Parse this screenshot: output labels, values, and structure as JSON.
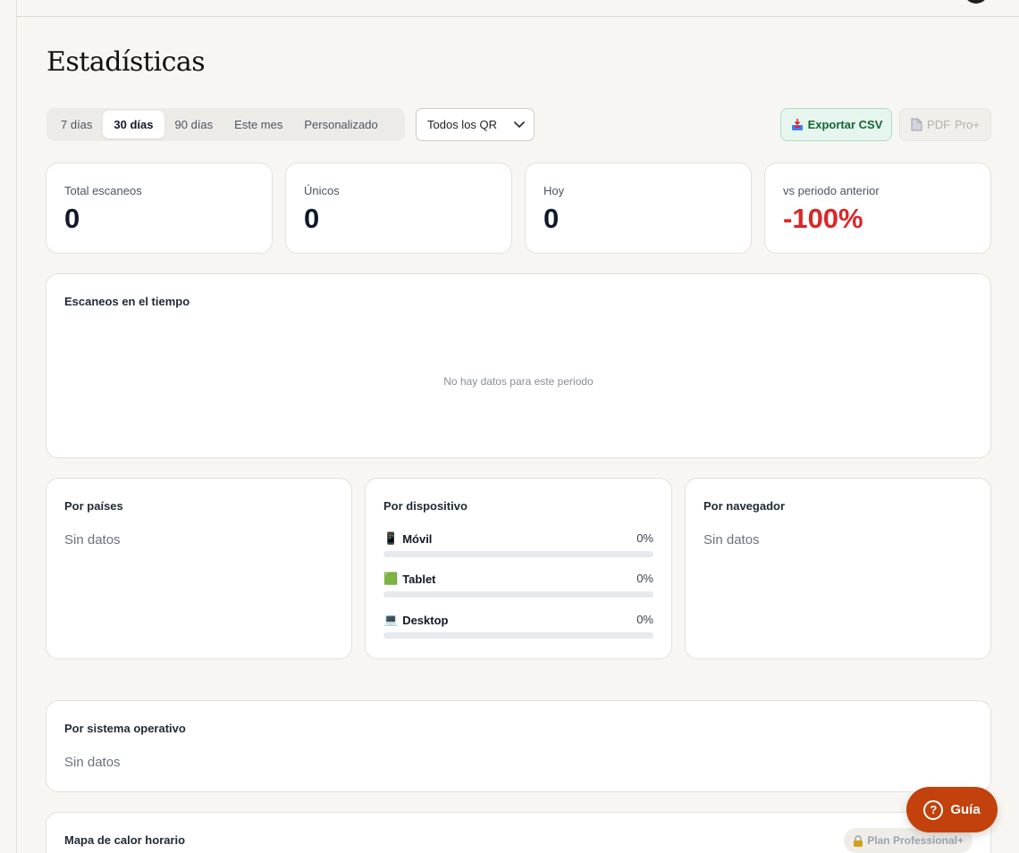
{
  "header": {
    "title": "Estadísticas"
  },
  "filters": {
    "ranges": [
      {
        "label": "7 días",
        "active": false
      },
      {
        "label": "30 días",
        "active": true
      },
      {
        "label": "90 días",
        "active": false
      },
      {
        "label": "Este mes",
        "active": false
      },
      {
        "label": "Personalizado",
        "active": false
      }
    ],
    "qr_select": {
      "value": "Todos los QR",
      "icon": "chevron-down-icon"
    }
  },
  "actions": {
    "csv": {
      "label": "Exportar CSV",
      "icon": "inbox-tray-icon"
    },
    "pdf": {
      "label": "PDF",
      "tag": "Pro+",
      "icon": "document-icon"
    }
  },
  "stats": [
    {
      "label": "Total escaneos",
      "value": "0"
    },
    {
      "label": "Únicos",
      "value": "0"
    },
    {
      "label": "Hoy",
      "value": "0"
    },
    {
      "label": "vs periodo anterior",
      "value": "-100%"
    }
  ],
  "timeline": {
    "title": "Escaneos en el tiempo",
    "empty": "No hay datos para este periodo"
  },
  "countries": {
    "title": "Por países",
    "empty": "Sin datos"
  },
  "devices": {
    "title": "Por dispositivo",
    "items": [
      {
        "icon": "📱",
        "label": "Móvil",
        "pct": "0%",
        "fraction": 0
      },
      {
        "icon": "🟩",
        "label": "Tablet",
        "pct": "0%",
        "fraction": 0
      },
      {
        "icon": "💻",
        "label": "Desktop",
        "pct": "0%",
        "fraction": 0
      }
    ]
  },
  "browsers": {
    "title": "Por navegador",
    "empty": "Sin datos"
  },
  "os": {
    "title": "Por sistema operativo",
    "empty": "Sin datos"
  },
  "heatmap": {
    "title": "Mapa de calor horario",
    "badge": "Plan Professional+",
    "badge_icon": "lock-icon"
  },
  "guide": {
    "label": "Guía",
    "icon": "question-circle-icon"
  },
  "colors": {
    "accent": "#c2410c",
    "negative": "#dc2626",
    "csv_bg": "#e6f6ee",
    "csv_text": "#166534"
  }
}
